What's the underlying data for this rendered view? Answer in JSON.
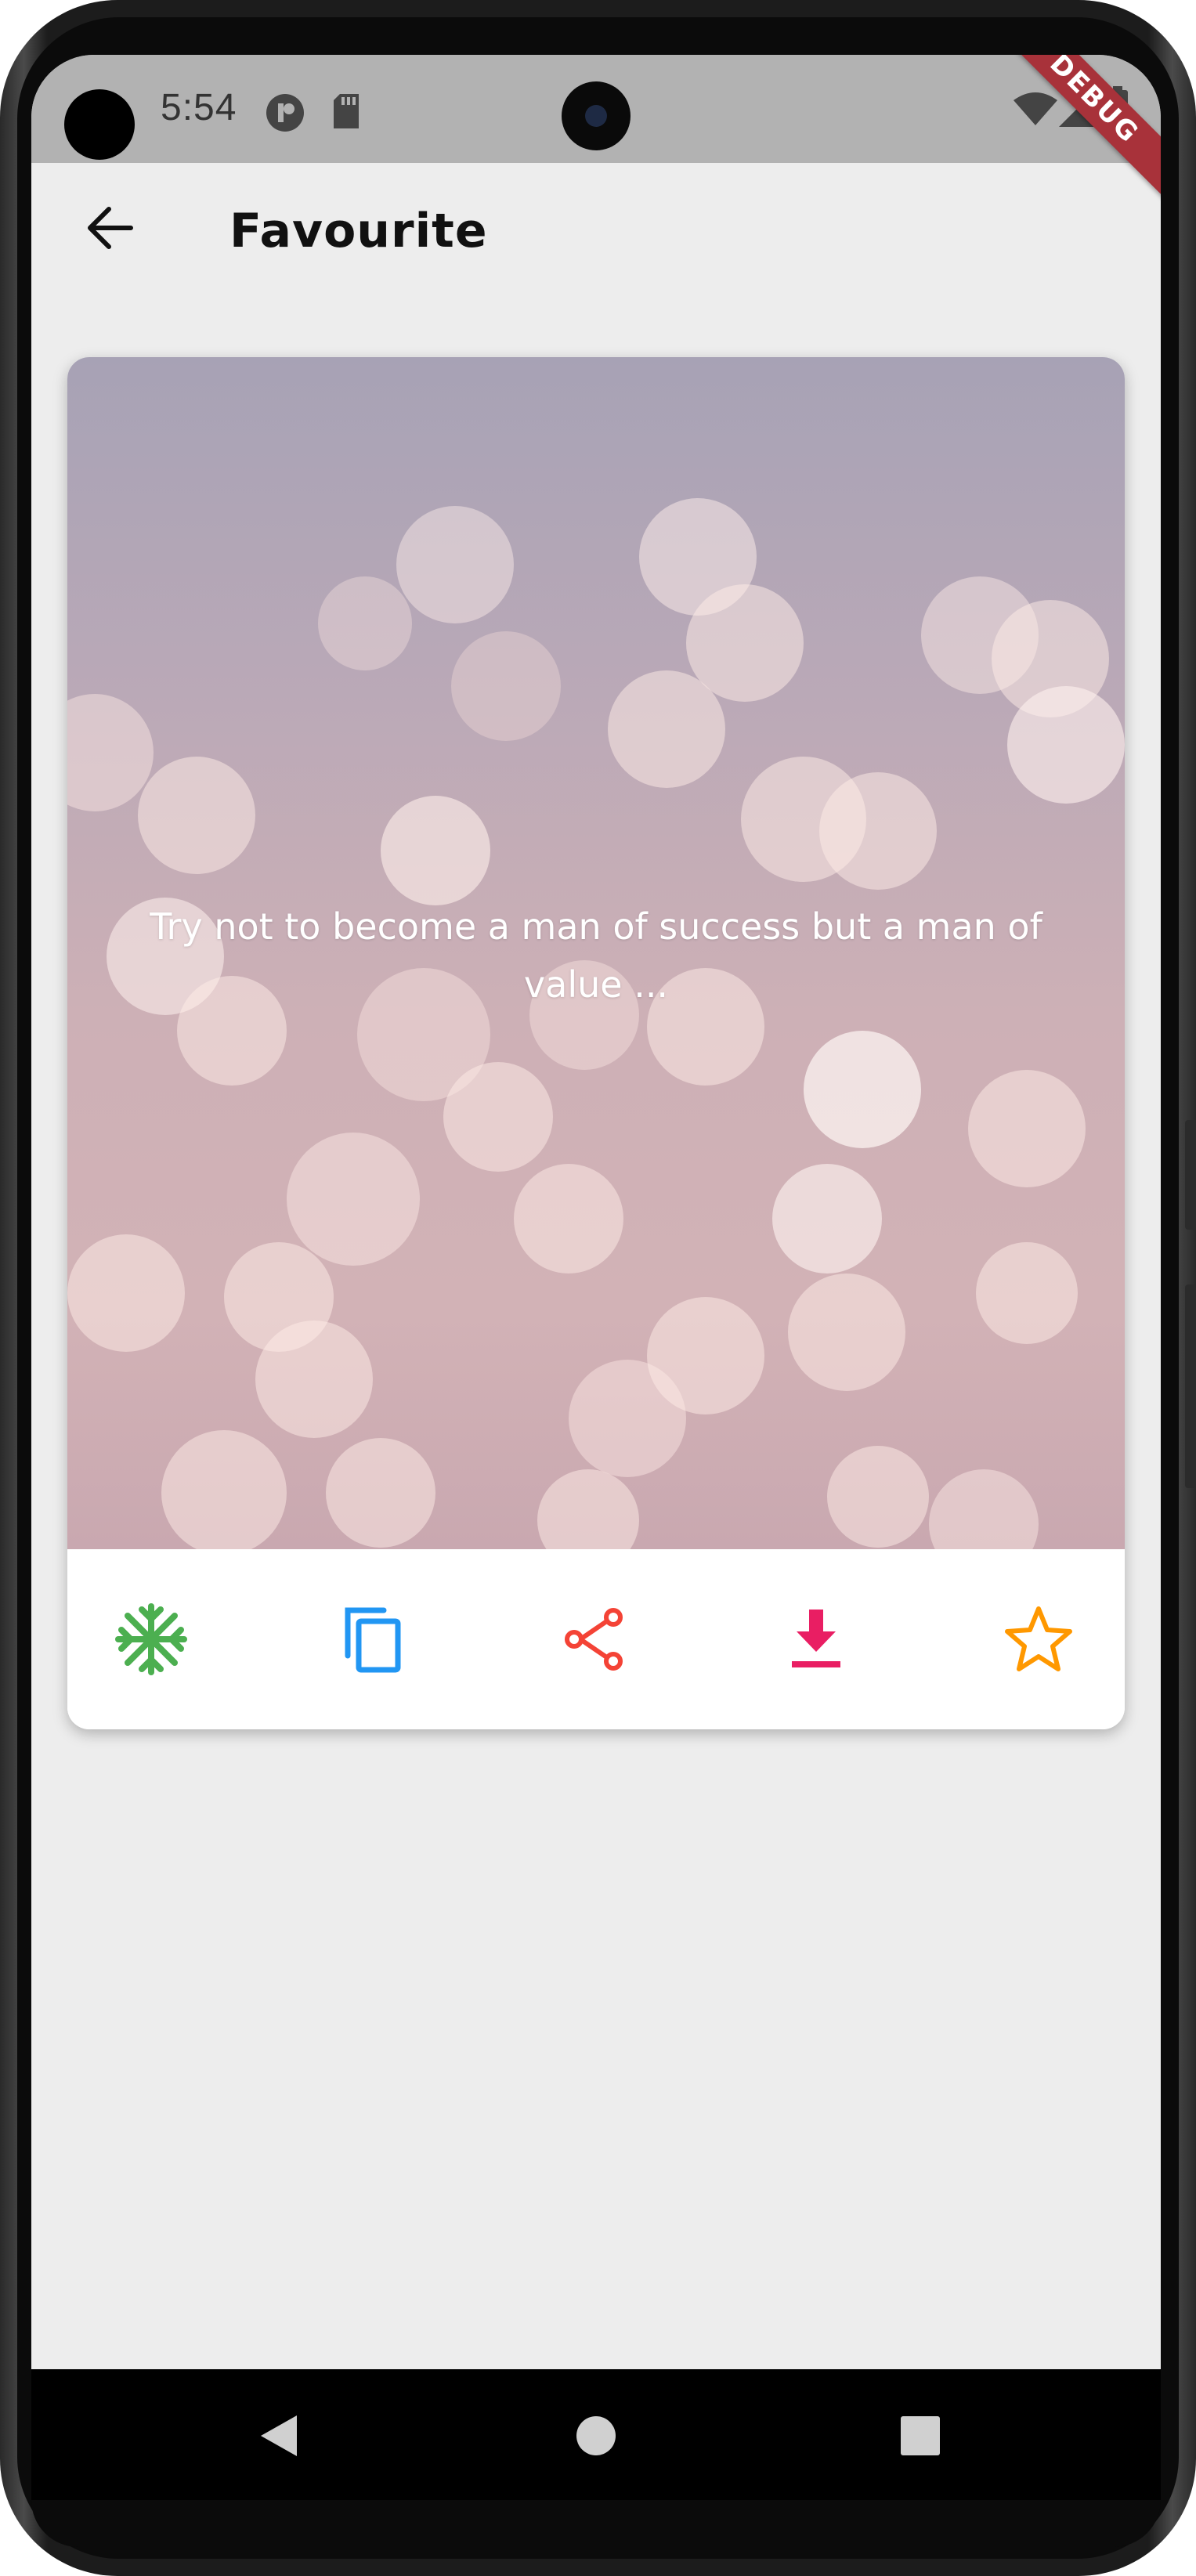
{
  "status_bar": {
    "time": "5:54",
    "icons": [
      "notification-icon",
      "sd-card-icon",
      "wifi-icon",
      "signal-icon",
      "battery-icon"
    ]
  },
  "debug_banner": "DEBUG",
  "app_bar": {
    "title": "Favourite",
    "back_icon": "arrow-back-icon"
  },
  "quote_card": {
    "text": "Try not to become a man of success but a man of value ...",
    "actions": [
      {
        "name": "snowflake-icon",
        "color": "#4caf50"
      },
      {
        "name": "copy-icon",
        "color": "#2196f3"
      },
      {
        "name": "share-icon",
        "color": "#f44336"
      },
      {
        "name": "download-icon",
        "color": "#e91e63"
      },
      {
        "name": "star-outline-icon",
        "color": "#ff9800"
      }
    ]
  },
  "nav_bar": {
    "buttons": [
      "back-triangle-icon",
      "home-circle-icon",
      "recents-square-icon"
    ]
  },
  "colors": {
    "screen_bg": "#ededed",
    "status_bar_bg": "#b2b2b2",
    "nav_bar_bg": "#000000",
    "card_bg": "#ffffff"
  }
}
